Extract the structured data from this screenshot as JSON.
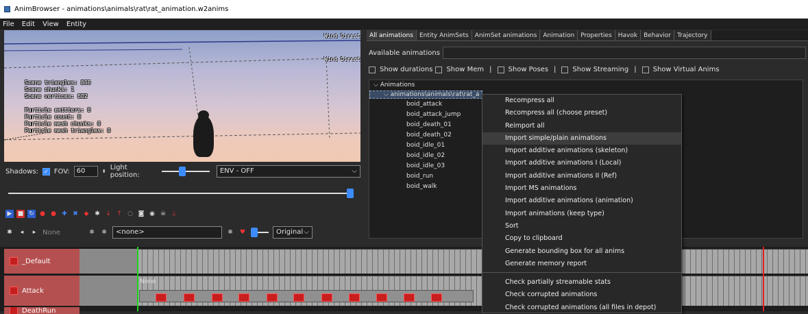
{
  "window": {
    "title": "AnimBrowser - animations\\animals\\rat\\rat_animation.w2anims"
  },
  "menu": [
    "File",
    "Edit",
    "View",
    "Entity"
  ],
  "viewport": {
    "wind_1": "Wind Direct",
    "wind_2": "Wind Direct",
    "stats": [
      "Scene triangles: 866",
      "Scene chunks: 1",
      "Scene vertices: 602",
      "",
      "Particle emitters: 0",
      "Particle count: 0",
      "Particle mesh chunks: 0",
      "Particle mesh triangles: 0"
    ]
  },
  "controls": {
    "shadows_label": "Shadows:",
    "fov_label": "FOV:",
    "fov_value": "60",
    "light_label": "Light position:",
    "env_value": "ENV - OFF",
    "none_placeholder": "None",
    "none_tag": "<none>",
    "original_value": "Original",
    "light_level": 0.4,
    "timeline_level": 1.0
  },
  "tabs": [
    "All animations",
    "Entity AnimSets",
    "AnimSet animations",
    "Animation",
    "Properties",
    "Havok",
    "Behavior",
    "Trajectory"
  ],
  "available_label": "Available animations",
  "checks": [
    "Show durations",
    "Show Mem",
    "Show Poses",
    "Show Streaming",
    "Show Virtual Anims"
  ],
  "tree": {
    "root": "Animations",
    "child": "animations\\animals\\rat\\rat_a",
    "items": [
      "boid_attack",
      "boid_attack_jump",
      "boid_death_01",
      "boid_death_02",
      "boid_idle_01",
      "boid_idle_02",
      "boid_idle_03",
      "boid_run",
      "boid_walk"
    ]
  },
  "context_menu": {
    "items": [
      "Recompress all",
      "Recompress all (choose preset)",
      "Reimport all",
      "Import simple/plain animations",
      "Import additive animations (skeleton)",
      "Import additive animations I (Local)",
      "Import additive animations II (Ref)",
      "Import MS animations",
      "Import additive animations (animation)",
      "Import animations (keep type)",
      "Sort",
      "Copy to clipboard",
      "Generate bounding box for all anims",
      "Generate memory report"
    ],
    "items2": [
      "Check partially streamable stats",
      "Check corrupted animations",
      "Check corrupted animations (all files in depot)"
    ]
  },
  "timeline": {
    "tracks": [
      "_Default",
      "Attack",
      "DeathRun"
    ],
    "attack_none": "None"
  }
}
